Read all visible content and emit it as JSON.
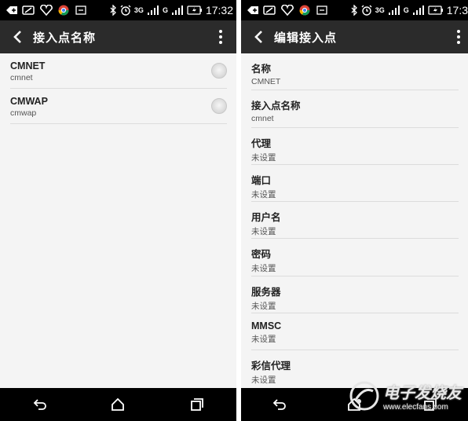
{
  "status_bar": {
    "left_icons": [
      "add-call-icon",
      "battery-saver-icon",
      "heart-icon",
      "chrome-icon",
      "screen-cast-icon"
    ],
    "right_icons": [
      "bluetooth-icon",
      "alarm-icon",
      "3g-signal-icon",
      "g-signal-icon",
      "battery-charging-icon"
    ],
    "network_3g": "3G",
    "network_g": "G",
    "time_left": "17:32",
    "time_right": "17:3"
  },
  "apn_list": {
    "title": "接入点名称",
    "items": [
      {
        "name": "CMNET",
        "apn": "cmnet",
        "selected": false
      },
      {
        "name": "CMWAP",
        "apn": "cmwap",
        "selected": false
      }
    ]
  },
  "edit_apn": {
    "title": "编辑接入点",
    "fields": [
      {
        "label": "名称",
        "value": "CMNET"
      },
      {
        "label": "接入点名称",
        "value": "cmnet"
      },
      {
        "label": "代理",
        "value": "未设置"
      },
      {
        "label": "端口",
        "value": "未设置"
      },
      {
        "label": "用户名",
        "value": "未设置"
      },
      {
        "label": "密码",
        "value": "未设置"
      },
      {
        "label": "服务器",
        "value": "未设置"
      },
      {
        "label": "MMSC",
        "value": "未设置"
      },
      {
        "label": "彩信代理",
        "value": "未设置"
      }
    ]
  },
  "nav_bar": {
    "buttons": [
      "back-nav-icon",
      "home-icon",
      "recents-icon"
    ]
  },
  "watermark": {
    "brand": "电子发烧友",
    "url": "www.elecfans.com"
  },
  "colors": {
    "status_bar": "#000000",
    "action_bar": "#2b2b2b",
    "list_background": "#f4f4f4",
    "divider": "#dcdcdc"
  }
}
